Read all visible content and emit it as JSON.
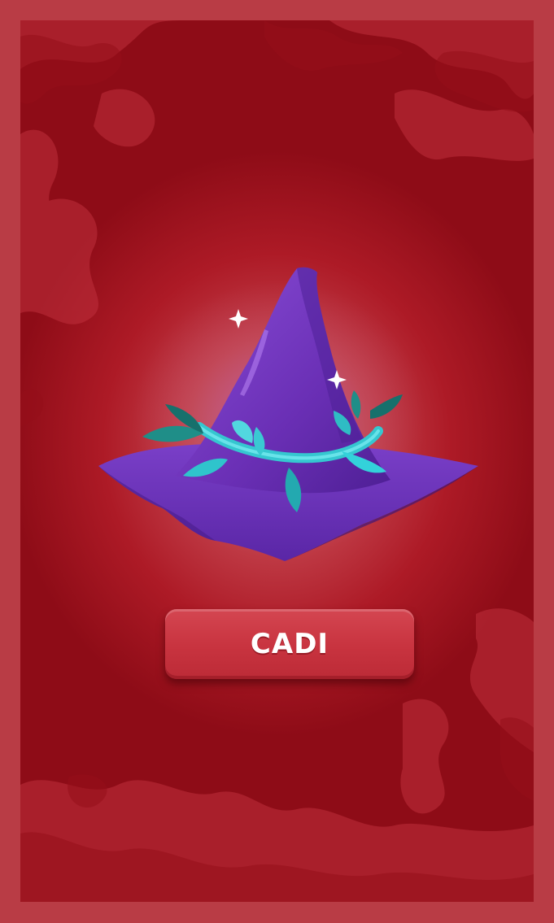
{
  "card": {
    "item_name": "CADI",
    "item_icon": "witch-hat-icon",
    "sparkle_icon": "sparkle-icon"
  },
  "colors": {
    "frame": "#b93c45",
    "background": "#ad1a26",
    "button": "#c8333f",
    "hat": "#6a2fb5",
    "leaves": "#2fc4cc"
  }
}
